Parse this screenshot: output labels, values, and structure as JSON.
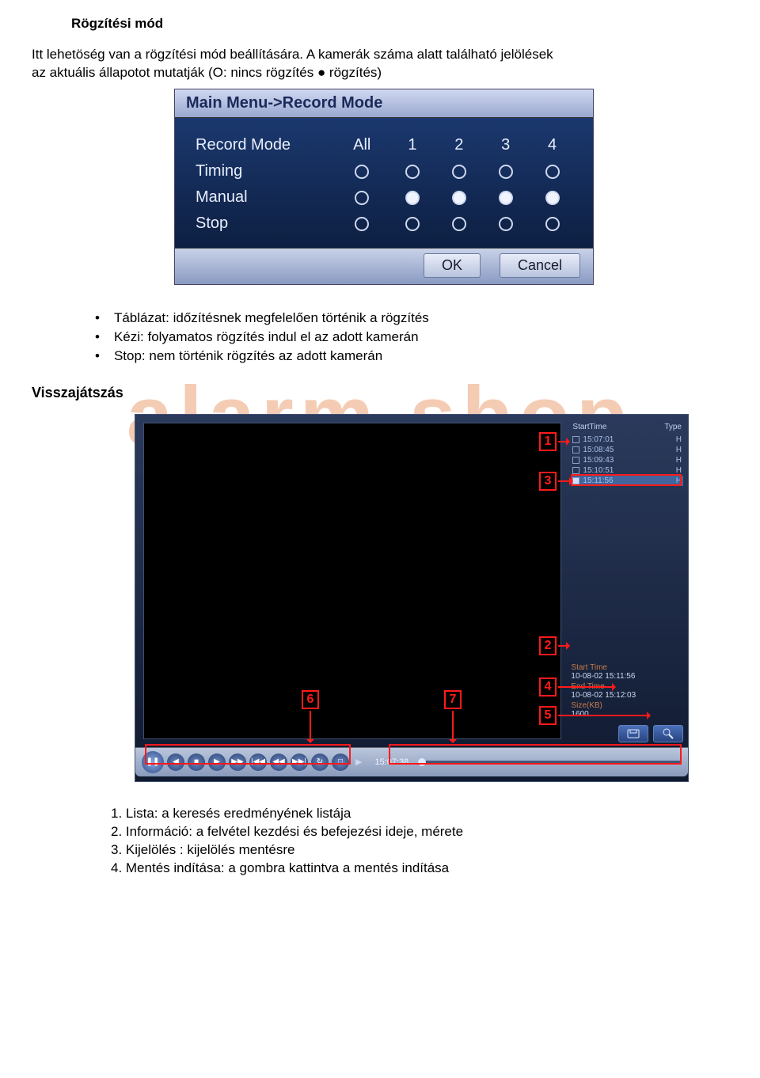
{
  "title": "Rögzítési mód",
  "intro_line1": "Itt lehetöség van a rögzítési mód beállítására. A kamerák száma alatt található jelölések",
  "intro_line2": "az aktuális állapotot mutatják (O: nincs rögzítés ● rögzítés)",
  "record_panel": {
    "breadcrumb": "Main Menu->Record Mode",
    "header_label": "Record Mode",
    "col_all": "All",
    "cols": [
      "1",
      "2",
      "3",
      "4"
    ],
    "rows": [
      {
        "label": "Timing",
        "all": false,
        "vals": [
          false,
          false,
          false,
          false
        ]
      },
      {
        "label": "Manual",
        "all": false,
        "vals": [
          true,
          true,
          true,
          true
        ]
      },
      {
        "label": "Stop",
        "all": false,
        "vals": [
          false,
          false,
          false,
          false
        ]
      }
    ],
    "ok": "OK",
    "cancel": "Cancel"
  },
  "bullets": [
    "Táblázat: időzítésnek megfelelően történik a rögzítés",
    "Kézi: folyamatos rögzítés indul el az adott kamerán",
    "Stop: nem történik rögzítés az adott kamerán"
  ],
  "watermark": "alarm shop",
  "heading2": "Visszajátszás",
  "playback": {
    "list_header_start": "StartTime",
    "list_header_type": "Type",
    "files": [
      {
        "time": "15:07:01",
        "type": "H",
        "checked": false
      },
      {
        "time": "15:08:45",
        "type": "H",
        "checked": false
      },
      {
        "time": "15:09:43",
        "type": "H",
        "checked": false
      },
      {
        "time": "15:10:51",
        "type": "H",
        "checked": false
      },
      {
        "time": "15:11:56",
        "type": "H",
        "checked": true
      }
    ],
    "info_start_label": "Start Time",
    "info_start": "10-08-02 15:11:56",
    "info_end_label": "End Time",
    "info_end": "10-08-02 15:12:03",
    "info_size_label": "Size(KB)",
    "info_size": "1600",
    "play_time": "15:07:38",
    "badges": {
      "1": "1",
      "2": "2",
      "3": "3",
      "4": "4",
      "5": "5",
      "6": "6",
      "7": "7"
    }
  },
  "legend": [
    "1. Lista: a keresés eredményének listája",
    "2. Információ: a felvétel kezdési és befejezési ideje, mérete",
    "3. Kijelölés : kijelölés mentésre",
    "4. Mentés indítása: a gombra kattintva a mentés indítása"
  ]
}
